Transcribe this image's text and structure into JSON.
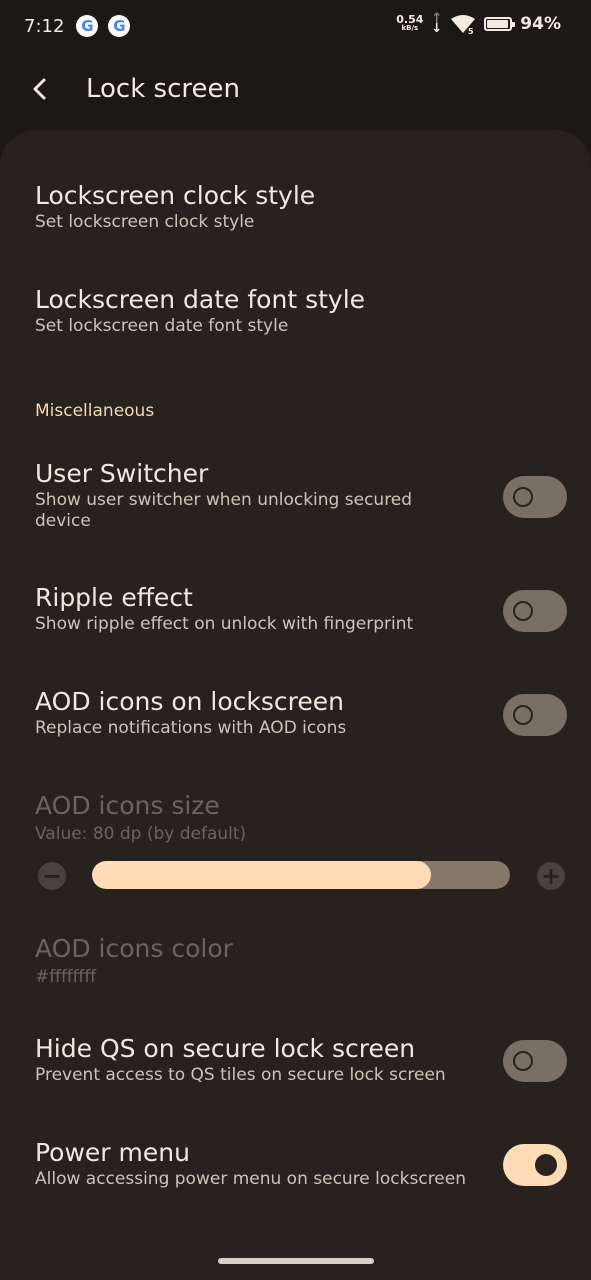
{
  "status": {
    "time": "7:12",
    "net_speed": "0.54",
    "net_unit": "kB/s",
    "wifi_badge": "5",
    "battery": "94%"
  },
  "header": {
    "title": "Lock screen"
  },
  "items": {
    "clock_style": {
      "title": "Lockscreen clock style",
      "summary": "Set lockscreen clock style"
    },
    "date_font": {
      "title": "Lockscreen date font style",
      "summary": "Set lockscreen date font style"
    },
    "misc_header": "Miscellaneous",
    "user_switcher": {
      "title": "User Switcher",
      "summary": "Show user switcher when unlocking secured device",
      "enabled": false
    },
    "ripple": {
      "title": "Ripple effect",
      "summary": "Show ripple effect on unlock with fingerprint",
      "enabled": false
    },
    "aod_icons": {
      "title": "AOD icons on lockscreen",
      "summary": "Replace notifications with AOD icons",
      "enabled": false
    },
    "aod_size": {
      "title": "AOD icons size",
      "summary": "Value: 80 dp (by default)",
      "level": 0.81,
      "minus": "−",
      "plus": "+"
    },
    "aod_color": {
      "title": "AOD icons color",
      "summary": "#ffffffff"
    },
    "hide_qs": {
      "title": "Hide QS on secure lock screen",
      "summary": "Prevent access to QS tiles on secure lock screen",
      "enabled": false
    },
    "power_menu": {
      "title": "Power menu",
      "summary": "Allow accessing power menu on secure lockscreen",
      "enabled": true
    }
  },
  "colors": {
    "background": "#1c1815",
    "panel": "#27221e",
    "accent": "#ffdcb5"
  }
}
